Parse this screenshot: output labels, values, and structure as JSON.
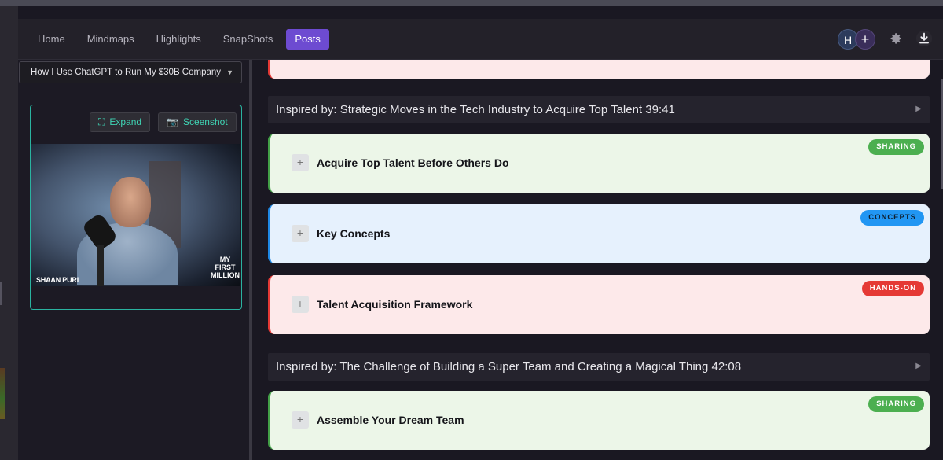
{
  "nav": {
    "items": [
      "Home",
      "Mindmaps",
      "Highlights",
      "SnapShots",
      "Posts"
    ],
    "active": "Posts"
  },
  "toolbar": {
    "avatar_initial": "H",
    "add_label": "+"
  },
  "sidebar": {
    "video_select": "How I Use ChatGPT to Run My $30B Company",
    "expand_label": "Expand",
    "screenshot_label": "Sceenshot",
    "video": {
      "name_tag": "SHAAN PURI",
      "logo_line1": "MY",
      "logo_line2": "FIRST",
      "logo_line3": "MILLION"
    }
  },
  "sections": [
    {
      "title": "Inspired by: Strategic Moves in the Tech Industry to Acquire Top Talent 39:41",
      "cards": [
        {
          "title": "Acquire Top Talent Before Others Do",
          "badge": "SHARING",
          "color": "green"
        },
        {
          "title": "Key Concepts",
          "badge": "CONCEPTS",
          "color": "blue"
        },
        {
          "title": "Talent Acquisition Framework",
          "badge": "HANDS-ON",
          "color": "red"
        }
      ]
    },
    {
      "title": "Inspired by: The Challenge of Building a Super Team and Creating a Magical Thing 42:08",
      "cards": [
        {
          "title": "Assemble Your Dream Team",
          "badge": "SHARING",
          "color": "green"
        }
      ]
    }
  ],
  "colors": {
    "accent": "#6d4bd1",
    "teal": "#3fd4b4",
    "sharing": "#4caf50",
    "concepts": "#2196f3",
    "handson": "#e53935"
  }
}
